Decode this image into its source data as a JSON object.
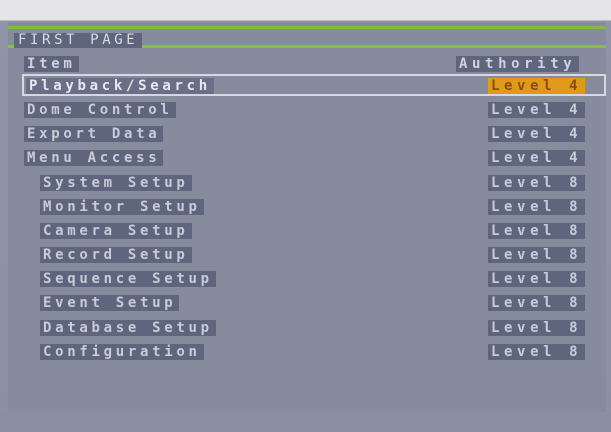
{
  "page_title": "FIRST PAGE",
  "columns": {
    "item": "Item",
    "authority": "Authority"
  },
  "rows": [
    {
      "item": "Playback/Search",
      "level": "Level 4",
      "selected": true
    },
    {
      "item": "Dome Control",
      "level": "Level 4"
    },
    {
      "item": "Export Data",
      "level": "Level 4"
    },
    {
      "item": "Menu Access",
      "level": "Level 4"
    },
    {
      "item": "System Setup",
      "level": "Level 8"
    },
    {
      "item": "Monitor Setup",
      "level": "Level 8"
    },
    {
      "item": "Camera Setup",
      "level": "Level 8"
    },
    {
      "item": "Record Setup",
      "level": "Level 8"
    },
    {
      "item": "Sequence Setup",
      "level": "Level 8"
    },
    {
      "item": "Event Setup",
      "level": "Level 8"
    },
    {
      "item": "Database Setup",
      "level": "Level 8"
    },
    {
      "item": "Configuration",
      "level": "Level 8"
    }
  ],
  "colors": {
    "accent_green": "#7bbf3a",
    "selected_level": "#e09a1a",
    "label_bg": "#5f657c",
    "panel_bg": "#868c9e"
  }
}
